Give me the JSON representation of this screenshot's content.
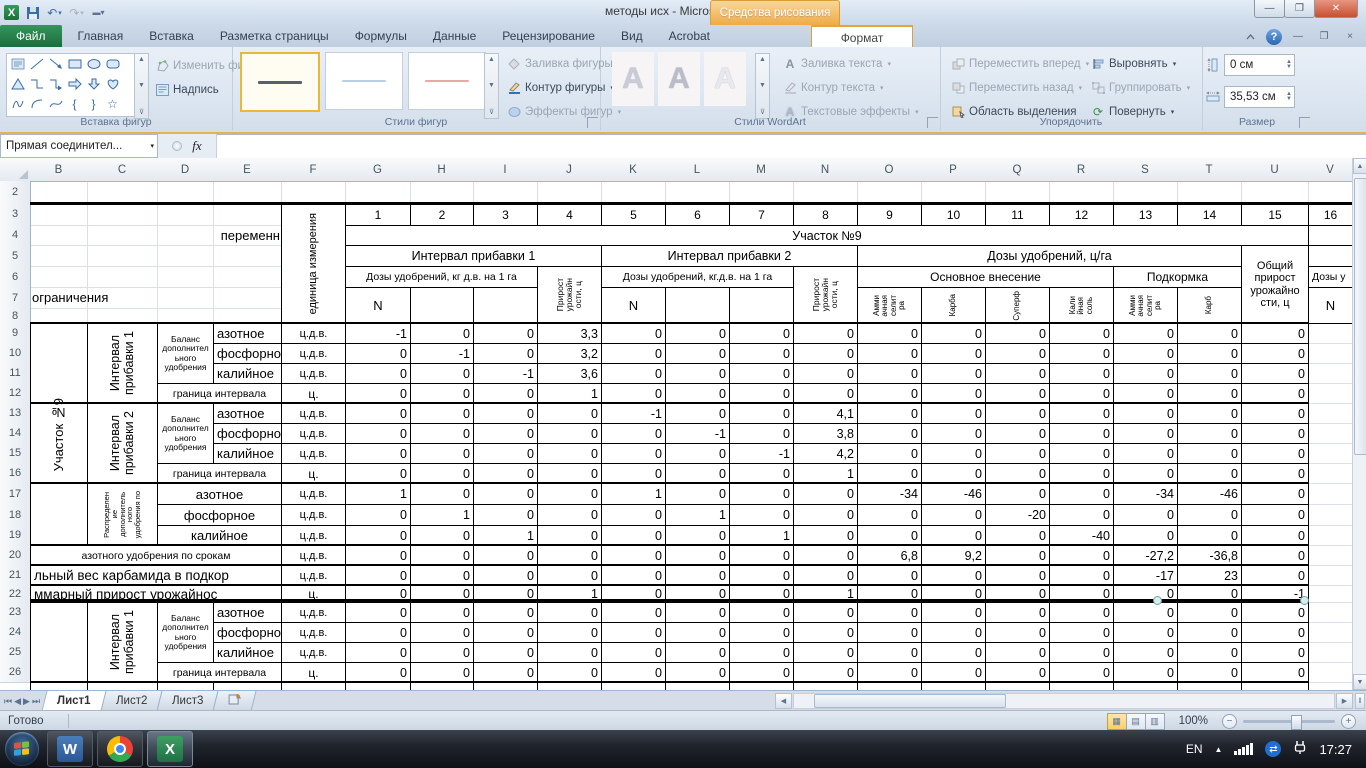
{
  "window": {
    "title": "методы исх  -  Microsoft Excel",
    "drawing_tools_label": "Средства рисования"
  },
  "tabs": {
    "file": "Файл",
    "items": [
      "Главная",
      "Вставка",
      "Разметка страницы",
      "Формулы",
      "Данные",
      "Рецензирование",
      "Вид",
      "Acrobat"
    ],
    "contextual": "Формат"
  },
  "ribbon": {
    "insert_shapes": {
      "label": "Вставка фигур",
      "edit_shape": "Изменить фигуру",
      "textbox": "Надпись"
    },
    "shape_styles": {
      "label": "Стили фигур",
      "fill": "Заливка фигуры",
      "outline": "Контур фигуры",
      "effects": "Эффекты фигур"
    },
    "wordart": {
      "label": "Стили WordArt",
      "letter": "A",
      "text_fill": "Заливка текста",
      "text_outline": "Контур текста",
      "text_effects": "Текстовые эффекты"
    },
    "arrange": {
      "label": "Упорядочить",
      "bring_forward": "Переместить вперед",
      "send_backward": "Переместить назад",
      "selection_pane": "Область выделения",
      "align": "Выровнять",
      "group": "Группировать",
      "rotate": "Повернуть"
    },
    "size": {
      "label": "Размер",
      "height_value": "0 см",
      "width_value": "35,53 см"
    }
  },
  "formula_bar": {
    "name_box": "Прямая соединител...",
    "fx_label": "fx"
  },
  "sheet": {
    "columns": [
      "B",
      "C",
      "D",
      "E",
      "F",
      "G",
      "H",
      "I",
      "J",
      "K",
      "L",
      "M",
      "N",
      "O",
      "P",
      "Q",
      "R",
      "S",
      "T",
      "U",
      "V"
    ],
    "row_numbers": [
      "2",
      "3",
      "4",
      "5",
      "6",
      "7",
      "8",
      "9",
      "10",
      "11",
      "12",
      "13",
      "14",
      "15",
      "16",
      "17",
      "18",
      "19",
      "20",
      "21",
      "22",
      "23",
      "24",
      "25",
      "26"
    ],
    "header": {
      "numbers": [
        "1",
        "2",
        "3",
        "4",
        "5",
        "6",
        "7",
        "8",
        "9",
        "10",
        "11",
        "12",
        "13",
        "14",
        "15",
        "16"
      ],
      "unit_strips": [
        "единица измерения"
      ],
      "peremennye": "переменн",
      "ogranicheniya": "ограничения",
      "uchastok": "Участок №9",
      "interval1": "Интервал прибавки 1",
      "interval2": "Интервал прибавки 2",
      "dozy1": "Дозы удобрений, кг д.в. на 1 га",
      "dozy2": "Дозы удобрений, кг.д.в. на 1 га",
      "prirost_strips": [
        "Прирост",
        "урожайн",
        "ости, ц"
      ],
      "dozy_c": "Дозы удобрений, ц/га",
      "osnovnoe": "Основное внесение",
      "podkormka": "Подкормка",
      "obshchiy_lines": [
        "Общий",
        "прирост",
        "урожайно",
        "сти, ц"
      ],
      "next_dozy": "Дозы у",
      "n": "N",
      "fert_strips": [
        [
          "Амми",
          "ачная",
          "селит",
          "ра"
        ],
        [
          "Карба"
        ],
        [
          "Суперф"
        ],
        [
          "Кали",
          "йная",
          "соль"
        ],
        [
          "Амми",
          "ачная",
          "селит",
          "ра"
        ],
        [
          "Карб"
        ]
      ]
    },
    "left": {
      "uchastok9_strips": [
        "Участок №9"
      ],
      "interval1_strips": [
        "Интервал",
        "прибавки 1"
      ],
      "interval2_strips": [
        "Интервал",
        "прибавки 2"
      ],
      "balans_lines": [
        "Баланс",
        "дополнител",
        "ьного",
        "удобрения"
      ],
      "raspred_strips": [
        "Распределен",
        "ие",
        "дополнитель",
        "ного",
        "удобрения по"
      ]
    },
    "rows": [
      {
        "n": "9",
        "type": "e",
        "label": "азотное",
        "unit": "ц.д.в.",
        "values": [
          "-1",
          "0",
          "0",
          "3,3",
          "0",
          "0",
          "0",
          "0",
          "0",
          "0",
          "0",
          "0",
          "0",
          "0",
          "0"
        ]
      },
      {
        "n": "10",
        "type": "e",
        "label": "фосфорное",
        "unit": "ц.д.в.",
        "values": [
          "0",
          "-1",
          "0",
          "3,2",
          "0",
          "0",
          "0",
          "0",
          "0",
          "0",
          "0",
          "0",
          "0",
          "0",
          "0"
        ]
      },
      {
        "n": "11",
        "type": "e",
        "label": "калийное",
        "unit": "ц.д.в.",
        "values": [
          "0",
          "0",
          "-1",
          "3,6",
          "0",
          "0",
          "0",
          "0",
          "0",
          "0",
          "0",
          "0",
          "0",
          "0",
          "0"
        ]
      },
      {
        "n": "12",
        "type": "de",
        "label": "граница интервала",
        "unit": "ц.",
        "values": [
          "0",
          "0",
          "0",
          "1",
          "0",
          "0",
          "0",
          "0",
          "0",
          "0",
          "0",
          "0",
          "0",
          "0",
          "0"
        ]
      },
      {
        "n": "13",
        "type": "e",
        "label": "азотное",
        "unit": "ц.д.в.",
        "values": [
          "0",
          "0",
          "0",
          "0",
          "-1",
          "0",
          "0",
          "4,1",
          "0",
          "0",
          "0",
          "0",
          "0",
          "0",
          "0"
        ]
      },
      {
        "n": "14",
        "type": "e",
        "label": "фосфорное",
        "unit": "ц.д.в.",
        "values": [
          "0",
          "0",
          "0",
          "0",
          "0",
          "-1",
          "0",
          "3,8",
          "0",
          "0",
          "0",
          "0",
          "0",
          "0",
          "0"
        ]
      },
      {
        "n": "15",
        "type": "e",
        "label": "калийное",
        "unit": "ц.д.в.",
        "values": [
          "0",
          "0",
          "0",
          "0",
          "0",
          "0",
          "-1",
          "4,2",
          "0",
          "0",
          "0",
          "0",
          "0",
          "0",
          "0"
        ]
      },
      {
        "n": "16",
        "type": "de",
        "label": "граница интервала",
        "unit": "ц.",
        "values": [
          "0",
          "0",
          "0",
          "0",
          "0",
          "0",
          "0",
          "1",
          "0",
          "0",
          "0",
          "0",
          "0",
          "0",
          "0"
        ]
      },
      {
        "n": "17",
        "type": "de2",
        "label": "азотное",
        "unit": "ц.д.в.",
        "values": [
          "1",
          "0",
          "0",
          "0",
          "1",
          "0",
          "0",
          "0",
          "-34",
          "-46",
          "0",
          "0",
          "-34",
          "-46",
          "0"
        ]
      },
      {
        "n": "18",
        "type": "de2",
        "label": "фосфорное",
        "unit": "ц.д.в.",
        "values": [
          "0",
          "1",
          "0",
          "0",
          "0",
          "1",
          "0",
          "0",
          "0",
          "0",
          "-20",
          "0",
          "0",
          "0",
          "0"
        ]
      },
      {
        "n": "19",
        "type": "de2",
        "label": "калийное",
        "unit": "ц.д.в.",
        "values": [
          "0",
          "0",
          "1",
          "0",
          "0",
          "0",
          "1",
          "0",
          "0",
          "0",
          "0",
          "-40",
          "0",
          "0",
          "0"
        ]
      },
      {
        "n": "20",
        "type": "be",
        "label": "азотного удобрения по срокам",
        "unit": "ц.д.в.",
        "values": [
          "0",
          "0",
          "0",
          "0",
          "0",
          "0",
          "0",
          "0",
          "6,8",
          "9,2",
          "0",
          "0",
          "-27,2",
          "-36,8",
          "0"
        ]
      },
      {
        "n": "21",
        "type": "be2",
        "label": "льный вес карбамида в подкор",
        "unit": "ц.д.в.",
        "values": [
          "0",
          "0",
          "0",
          "0",
          "0",
          "0",
          "0",
          "0",
          "0",
          "0",
          "0",
          "0",
          "-17",
          "23",
          "0"
        ]
      },
      {
        "n": "22",
        "type": "be2",
        "label": "ммарный прирост урожайнос",
        "unit": "ц.",
        "values": [
          "0",
          "0",
          "0",
          "1",
          "0",
          "0",
          "0",
          "1",
          "0",
          "0",
          "0",
          "0",
          "0",
          "0",
          "-1"
        ]
      },
      {
        "n": "23",
        "type": "e",
        "label": "азотное",
        "unit": "ц.д.в.",
        "values": [
          "0",
          "0",
          "0",
          "0",
          "0",
          "0",
          "0",
          "0",
          "0",
          "0",
          "0",
          "0",
          "0",
          "0",
          "0"
        ]
      },
      {
        "n": "24",
        "type": "e",
        "label": "фосфорное",
        "unit": "ц.д.в.",
        "values": [
          "0",
          "0",
          "0",
          "0",
          "0",
          "0",
          "0",
          "0",
          "0",
          "0",
          "0",
          "0",
          "0",
          "0",
          "0"
        ]
      },
      {
        "n": "25",
        "type": "e",
        "label": "калийное",
        "unit": "ц.д.в.",
        "values": [
          "0",
          "0",
          "0",
          "0",
          "0",
          "0",
          "0",
          "0",
          "0",
          "0",
          "0",
          "0",
          "0",
          "0",
          "0"
        ]
      },
      {
        "n": "26",
        "type": "de",
        "label": "граница интервала",
        "unit": "ц.",
        "values": [
          "0",
          "0",
          "0",
          "0",
          "0",
          "0",
          "0",
          "0",
          "0",
          "0",
          "0",
          "0",
          "0",
          "0",
          "0"
        ]
      }
    ]
  },
  "sheet_tabs": {
    "items": [
      "Лист1",
      "Лист2",
      "Лист3"
    ]
  },
  "status_bar": {
    "mode": "Готово",
    "zoom_level": "100%"
  },
  "taskbar": {
    "language": "EN",
    "time": "17:27"
  }
}
